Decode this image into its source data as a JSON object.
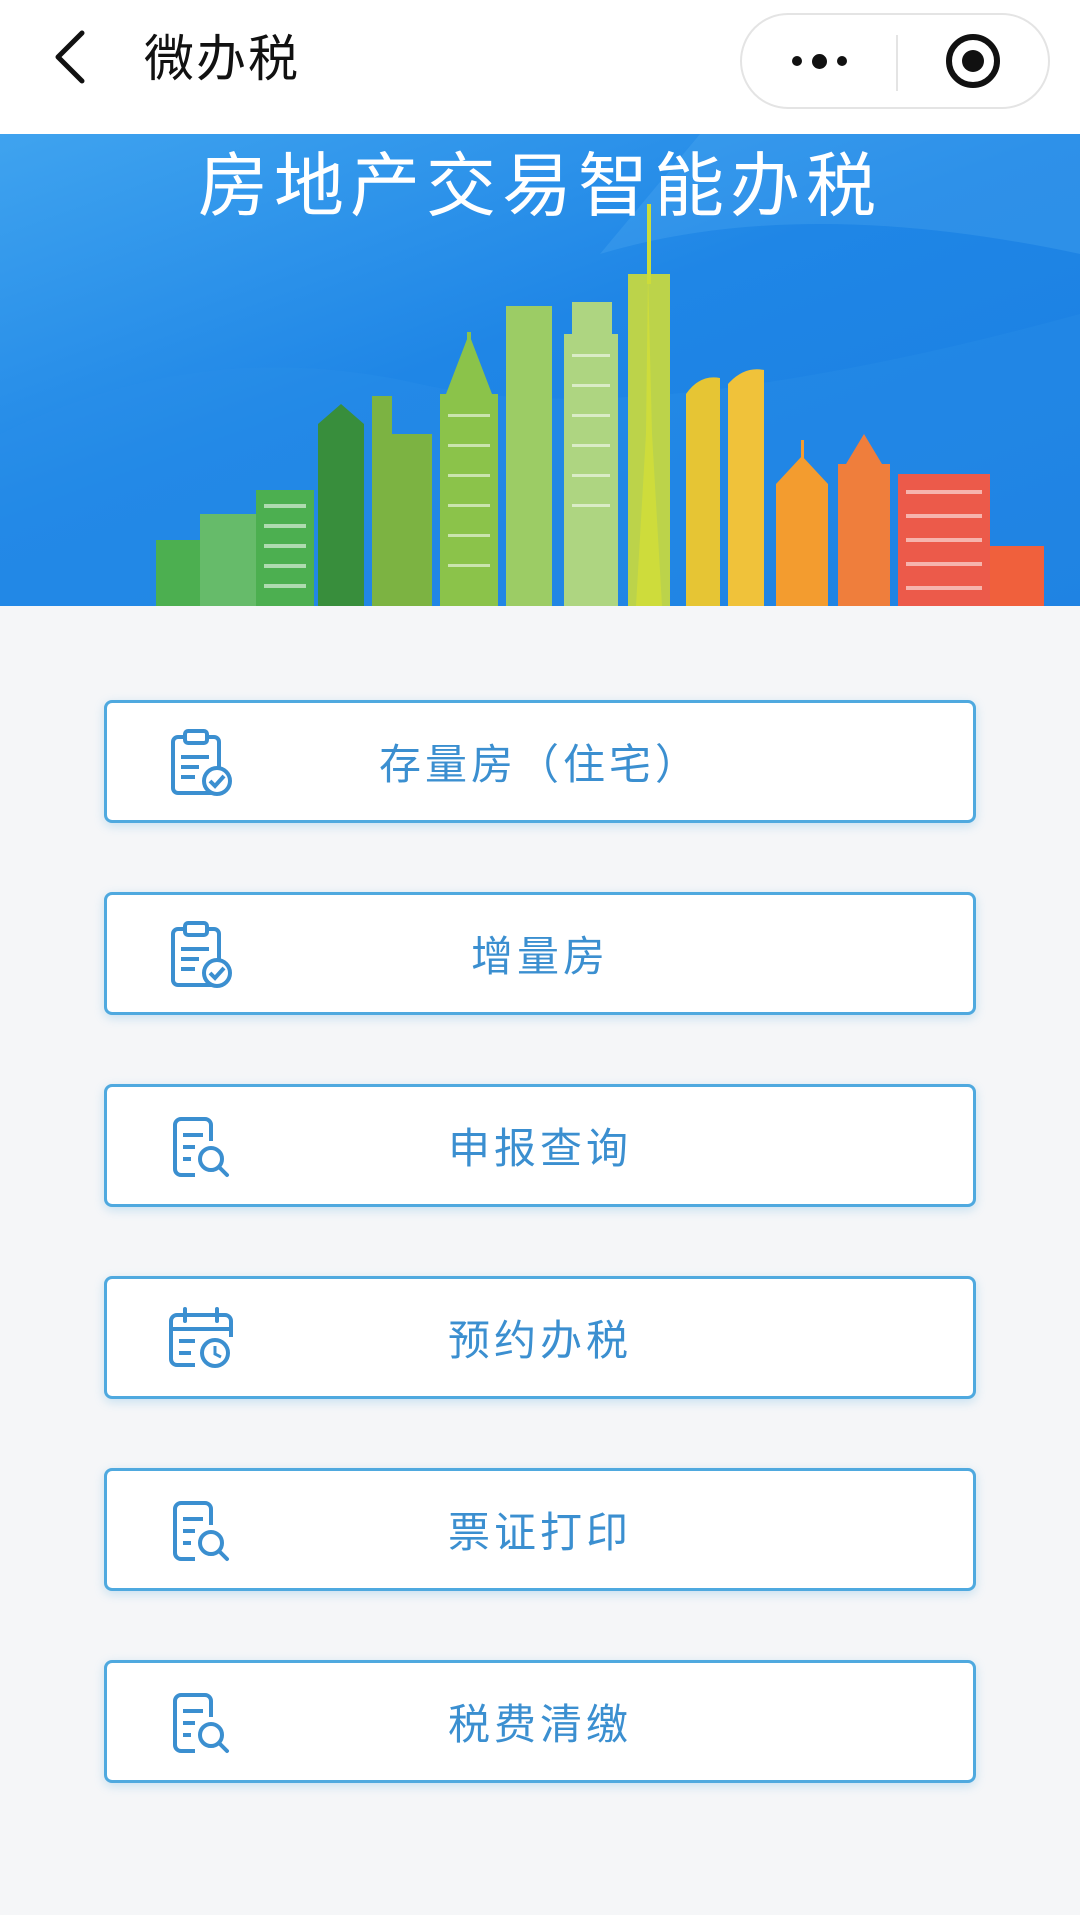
{
  "navbar": {
    "title": "微办税",
    "back_icon": "chevron-left-icon",
    "more_icon": "more-dots-icon",
    "close_icon": "record-circle-icon"
  },
  "banner": {
    "title": "房地产交易智能办税"
  },
  "menu": {
    "items": [
      {
        "label": "存量房（住宅）",
        "icon": "clipboard-check-icon"
      },
      {
        "label": "增量房",
        "icon": "clipboard-check-icon"
      },
      {
        "label": "申报查询",
        "icon": "document-search-icon"
      },
      {
        "label": "预约办税",
        "icon": "calendar-clock-icon"
      },
      {
        "label": "票证打印",
        "icon": "document-search-icon"
      },
      {
        "label": "税费清缴",
        "icon": "document-search-icon"
      }
    ]
  },
  "colors": {
    "accent": "#3b8fd0",
    "border": "#4fa9df",
    "banner": "#1f86e6",
    "background": "#f5f6f8"
  }
}
